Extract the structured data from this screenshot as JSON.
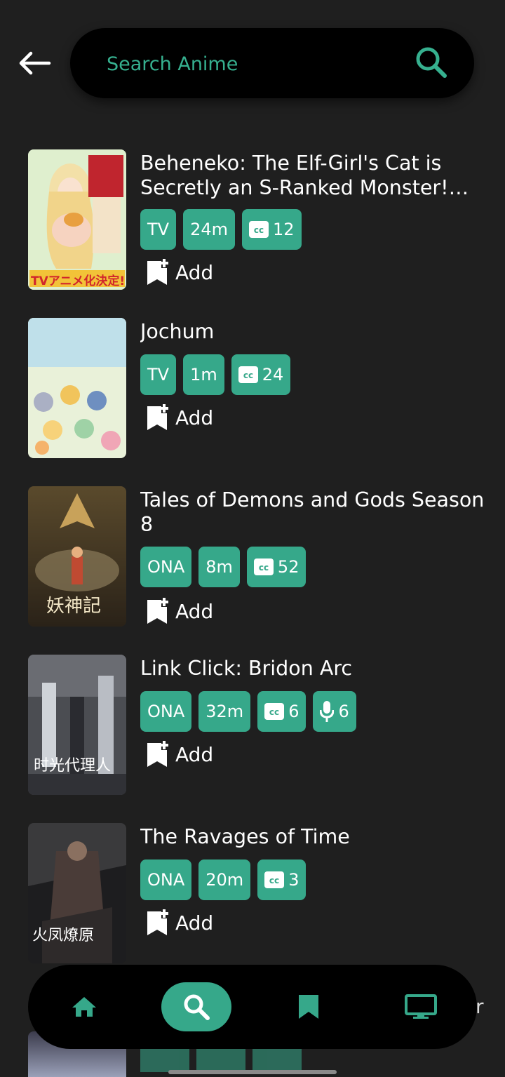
{
  "search": {
    "placeholder": "Search Anime"
  },
  "results": [
    {
      "title": "Beheneko: The Elf-Girl's Cat is Secretly an S-Ranked Monster! [Uncensored]",
      "badges": [
        {
          "type": "text",
          "text": "TV"
        },
        {
          "type": "text",
          "text": "24m"
        },
        {
          "type": "cc",
          "text": "12"
        }
      ],
      "add_label": "Add",
      "poster_text": "TVアニメ化決定!"
    },
    {
      "title": "Jochum",
      "badges": [
        {
          "type": "text",
          "text": "TV"
        },
        {
          "type": "text",
          "text": "1m"
        },
        {
          "type": "cc",
          "text": "24"
        }
      ],
      "add_label": "Add"
    },
    {
      "title": "Tales of Demons and Gods Season 8",
      "badges": [
        {
          "type": "text",
          "text": "ONA"
        },
        {
          "type": "text",
          "text": "8m"
        },
        {
          "type": "cc",
          "text": "52"
        }
      ],
      "add_label": "Add",
      "poster_text": "妖神記"
    },
    {
      "title": "Link Click: Bridon Arc",
      "badges": [
        {
          "type": "text",
          "text": "ONA"
        },
        {
          "type": "text",
          "text": "32m"
        },
        {
          "type": "cc",
          "text": "6"
        },
        {
          "type": "mic",
          "text": "6"
        }
      ],
      "add_label": "Add",
      "poster_text": "时光代理人"
    },
    {
      "title": "The Ravages of Time",
      "badges": [
        {
          "type": "text",
          "text": "ONA"
        },
        {
          "type": "text",
          "text": "20m"
        },
        {
          "type": "cc",
          "text": "3"
        }
      ],
      "add_label": "Add",
      "poster_text": "火凤燎原"
    }
  ],
  "nav": {
    "items": [
      {
        "name": "home",
        "icon": "home-icon",
        "active": false
      },
      {
        "name": "search",
        "icon": "search-icon",
        "active": true
      },
      {
        "name": "bookmarks",
        "icon": "bookmark-icon",
        "active": false
      },
      {
        "name": "tv",
        "icon": "tv-icon",
        "active": false
      }
    ]
  },
  "peek_text": "r",
  "colors": {
    "accent": "#36a88a",
    "background": "#1f1f1f",
    "bar": "#000000"
  }
}
